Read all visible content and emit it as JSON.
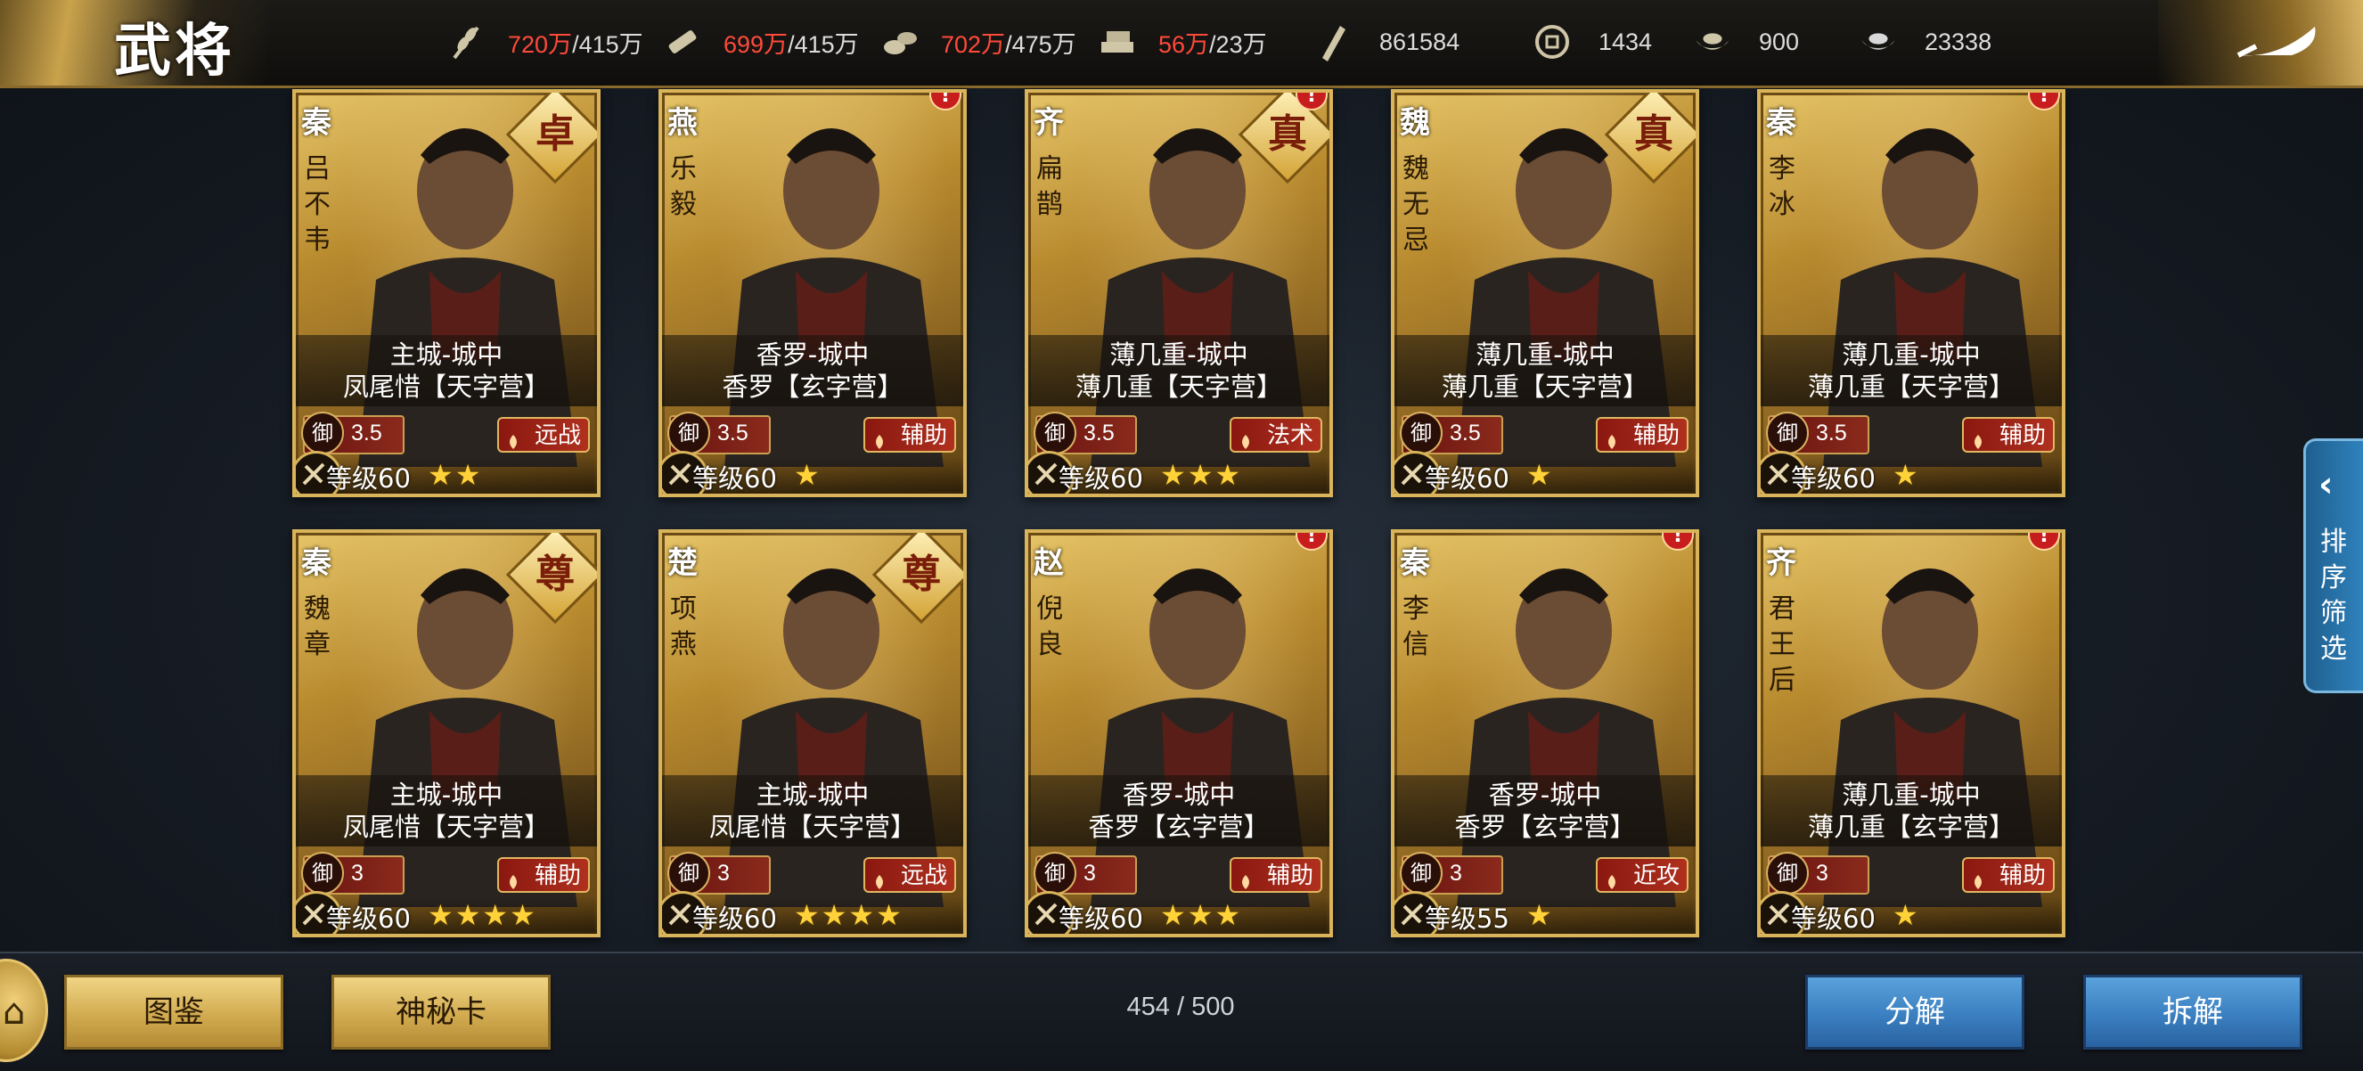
{
  "header": {
    "title": "武将",
    "resources": [
      {
        "icon": "grain-icon",
        "current": "720万",
        "max": "/415万"
      },
      {
        "icon": "wood-icon",
        "current": "699万",
        "max": "/415万"
      },
      {
        "icon": "stone-icon",
        "current": "702万",
        "max": "/475万"
      },
      {
        "icon": "iron-icon",
        "current": "56万",
        "max": "/23万"
      },
      {
        "icon": "scroll-icon",
        "current": "",
        "max": "861584"
      },
      {
        "icon": "copper-coin-icon",
        "current": "",
        "max": "1434"
      },
      {
        "icon": "gold-ingot-icon",
        "current": "",
        "max": "900"
      },
      {
        "icon": "silver-ingot-icon",
        "current": "",
        "max": "23338"
      }
    ]
  },
  "generals": [
    {
      "nation": "秦",
      "name": "吕不韦",
      "rank": "卓",
      "alert": false,
      "location": "主城-城中",
      "unit": "凤尾惜【天字营】",
      "defense": "3.5",
      "role": "远战",
      "role_icon": "bow-icon",
      "type_icon": "archer-type-icon",
      "level": "等级60",
      "stars": "★★"
    },
    {
      "nation": "燕",
      "name": "乐毅",
      "rank": "",
      "alert": true,
      "location": "香罗-城中",
      "unit": "香罗【玄字营】",
      "defense": "3.5",
      "role": "辅助",
      "role_icon": "lotus-icon",
      "type_icon": "cavalry-type-icon",
      "level": "等级60",
      "stars": "★"
    },
    {
      "nation": "齐",
      "name": "扁鹊",
      "rank": "真",
      "alert": true,
      "location": "薄几重-城中",
      "unit": "薄几重【天字营】",
      "defense": "3.5",
      "role": "法术",
      "role_icon": "staff-icon",
      "type_icon": "mage-type-icon",
      "level": "等级60",
      "stars": "★★★"
    },
    {
      "nation": "魏",
      "name": "魏无忌",
      "rank": "真",
      "alert": false,
      "location": "薄几重-城中",
      "unit": "薄几重【天字营】",
      "defense": "3.5",
      "role": "辅助",
      "role_icon": "lotus-icon",
      "type_icon": "shield-type-icon",
      "level": "等级60",
      "stars": "★"
    },
    {
      "nation": "秦",
      "name": "李冰",
      "rank": "",
      "alert": true,
      "location": "薄几重-城中",
      "unit": "薄几重【天字营】",
      "defense": "3.5",
      "role": "辅助",
      "role_icon": "lotus-icon",
      "type_icon": "mage-type-icon",
      "level": "等级60",
      "stars": "★"
    },
    {
      "nation": "秦",
      "name": "魏章",
      "rank": "尊",
      "alert": false,
      "location": "主城-城中",
      "unit": "凤尾惜【天字营】",
      "defense": "3",
      "role": "辅助",
      "role_icon": "lotus-icon",
      "type_icon": "archer-type-icon",
      "level": "等级60",
      "stars": "★★★★"
    },
    {
      "nation": "楚",
      "name": "项燕",
      "rank": "尊",
      "alert": false,
      "location": "主城-城中",
      "unit": "凤尾惜【天字营】",
      "defense": "3",
      "role": "远战",
      "role_icon": "bow-icon",
      "type_icon": "archer-type-icon",
      "level": "等级60",
      "stars": "★★★★"
    },
    {
      "nation": "赵",
      "name": "倪良",
      "rank": "",
      "alert": true,
      "location": "香罗-城中",
      "unit": "香罗【玄字营】",
      "defense": "3",
      "role": "辅助",
      "role_icon": "lotus-icon",
      "type_icon": "spear-type-icon",
      "level": "等级60",
      "stars": "★★★"
    },
    {
      "nation": "秦",
      "name": "李信",
      "rank": "",
      "alert": true,
      "location": "香罗-城中",
      "unit": "香罗【玄字营】",
      "defense": "3",
      "role": "近攻",
      "role_icon": "sword-icon",
      "type_icon": "cavalry-type-icon",
      "level": "等级55",
      "stars": "★"
    },
    {
      "nation": "齐",
      "name": "君王后",
      "rank": "",
      "alert": true,
      "location": "薄几重-城中",
      "unit": "薄几重【玄字营】",
      "defense": "3",
      "role": "辅助",
      "role_icon": "lotus-icon",
      "type_icon": "archer-type-icon",
      "level": "等级60",
      "stars": "★"
    }
  ],
  "sidebar": {
    "label": "排序筛选",
    "icon": "chevron-left-icon"
  },
  "footer": {
    "home_icon": "home-icon",
    "catalog": "图鉴",
    "mystery_card": "神秘卡",
    "count": "454 / 500",
    "decompose": "分解",
    "dismantle": "拆解"
  },
  "colors": {
    "accent_red": "#ff4a3a",
    "gold": "#d9b45a",
    "blue_button": "#3a7fc0"
  }
}
